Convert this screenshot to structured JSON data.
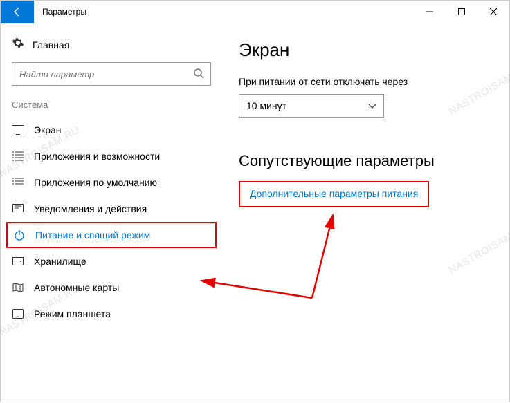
{
  "titlebar": {
    "title": "Параметры"
  },
  "sidebar": {
    "home": "Главная",
    "search_placeholder": "Найти параметр",
    "category": "Система",
    "items": [
      {
        "label": "Экран"
      },
      {
        "label": "Приложения и возможности"
      },
      {
        "label": "Приложения по умолчанию"
      },
      {
        "label": "Уведомления и действия"
      },
      {
        "label": "Питание и спящий режим"
      },
      {
        "label": "Хранилище"
      },
      {
        "label": "Автономные карты"
      },
      {
        "label": "Режим планшета"
      }
    ]
  },
  "main": {
    "heading1": "Экран",
    "field_label": "При питании от сети отключать через",
    "select_value": "10 минут",
    "heading2": "Сопутствующие параметры",
    "link": "Дополнительные параметры питания"
  },
  "watermark": "NASTROISAM.RU"
}
